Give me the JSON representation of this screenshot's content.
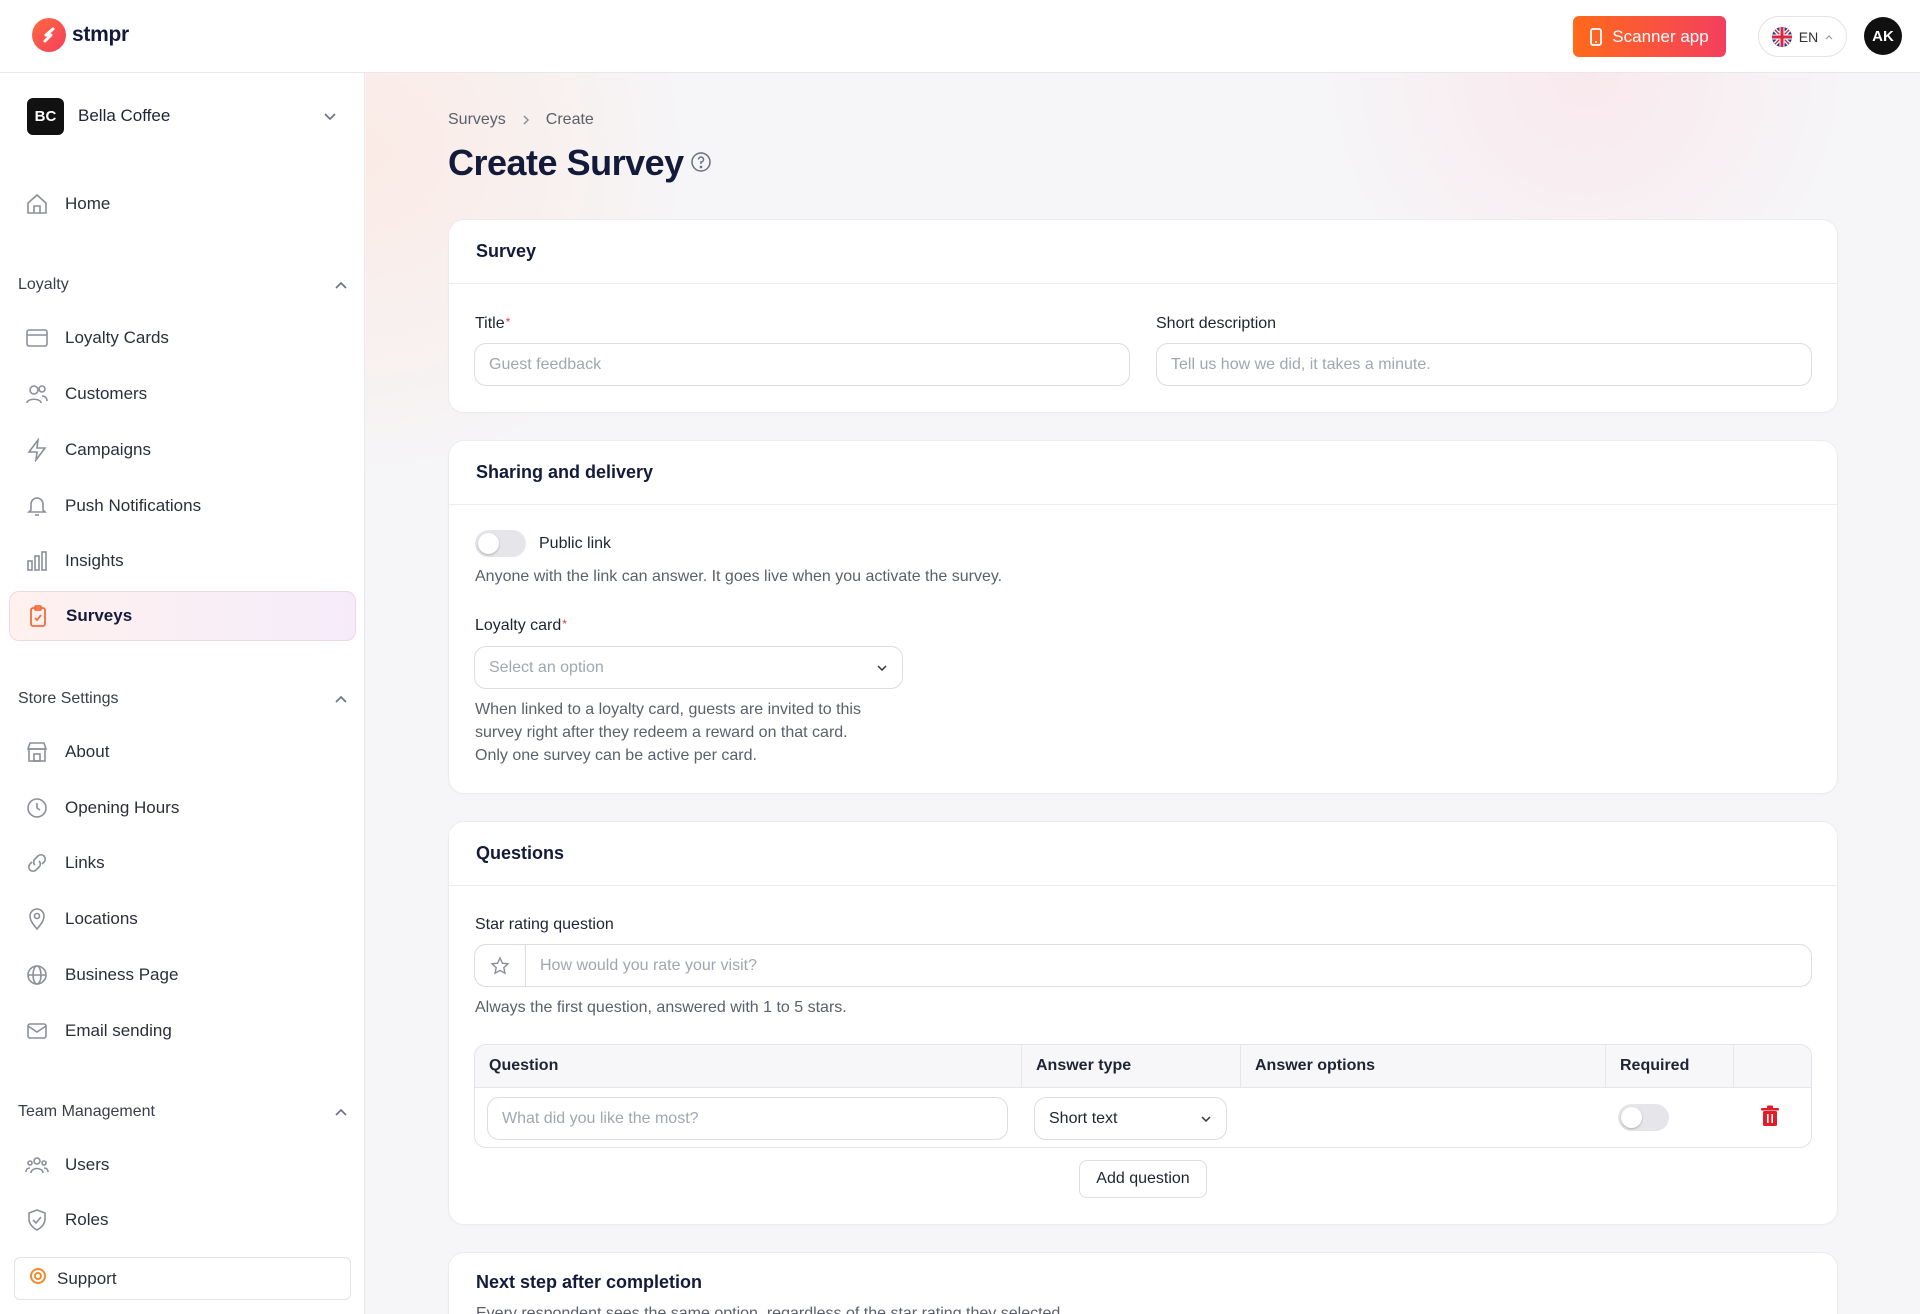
{
  "header": {
    "logo_text": "stmpr",
    "scanner_label": "Scanner app",
    "language": "EN",
    "user_initials": "AK"
  },
  "sidebar": {
    "store": {
      "initials": "BC",
      "name": "Bella Coffee"
    },
    "home": "Home",
    "sections": {
      "loyalty": "Loyalty",
      "store_settings": "Store Settings",
      "team": "Team Management"
    },
    "loyalty_items": [
      "Loyalty Cards",
      "Customers",
      "Campaigns",
      "Push Notifications",
      "Insights",
      "Surveys"
    ],
    "store_items": [
      "About",
      "Opening Hours",
      "Links",
      "Locations",
      "Business Page",
      "Email sending"
    ],
    "team_items": [
      "Users",
      "Roles"
    ],
    "support": "Support"
  },
  "breadcrumb": {
    "parent": "Surveys",
    "current": "Create"
  },
  "page_title": "Create Survey",
  "survey_card": {
    "heading": "Survey",
    "title_label": "Title",
    "title_placeholder": "Guest feedback",
    "desc_label": "Short description",
    "desc_placeholder": "Tell us how we did, it takes a minute."
  },
  "sharing_card": {
    "heading": "Sharing and delivery",
    "public_link_label": "Public link",
    "public_link_help": "Anyone with the link can answer. It goes live when you activate the survey.",
    "loyalty_label": "Loyalty card",
    "loyalty_placeholder": "Select an option",
    "loyalty_help_1": "When linked to a loyalty card, guests are invited to this",
    "loyalty_help_2": "survey right after they redeem a reward on that card.",
    "loyalty_help_3": "Only one survey can be active per card."
  },
  "questions_card": {
    "heading": "Questions",
    "star_label": "Star rating question",
    "star_placeholder": "How would you rate your visit?",
    "star_help": "Always the first question, answered with 1 to 5 stars.",
    "columns": {
      "question": "Question",
      "answer_type": "Answer type",
      "answer_options": "Answer options",
      "required": "Required"
    },
    "row": {
      "question_placeholder": "What did you like the most?",
      "answer_type": "Short text",
      "required": false
    },
    "add_label": "Add question"
  },
  "next_card": {
    "heading": "Next step after completion",
    "subtitle": "Every respondent sees the same option, regardless of the star rating they selected."
  }
}
